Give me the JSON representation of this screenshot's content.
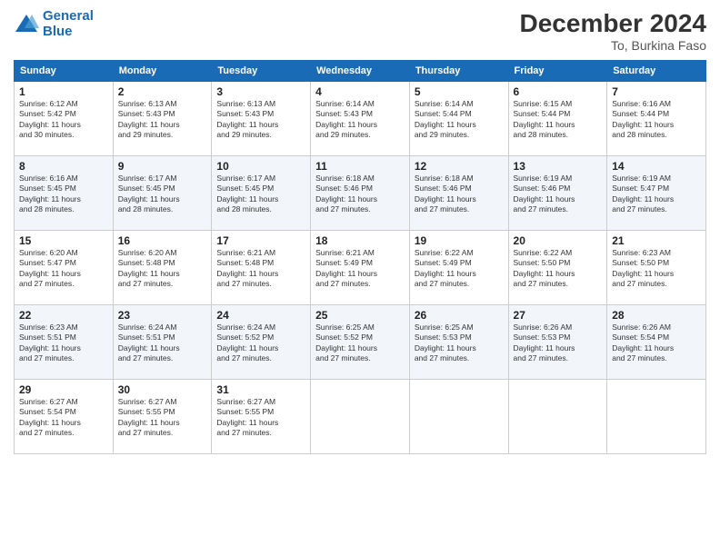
{
  "logo": {
    "line1": "General",
    "line2": "Blue"
  },
  "title": "December 2024",
  "location": "To, Burkina Faso",
  "days_header": [
    "Sunday",
    "Monday",
    "Tuesday",
    "Wednesday",
    "Thursday",
    "Friday",
    "Saturday"
  ],
  "weeks": [
    [
      {
        "day": "1",
        "info": "Sunrise: 6:12 AM\nSunset: 5:42 PM\nDaylight: 11 hours\nand 30 minutes."
      },
      {
        "day": "2",
        "info": "Sunrise: 6:13 AM\nSunset: 5:43 PM\nDaylight: 11 hours\nand 29 minutes."
      },
      {
        "day": "3",
        "info": "Sunrise: 6:13 AM\nSunset: 5:43 PM\nDaylight: 11 hours\nand 29 minutes."
      },
      {
        "day": "4",
        "info": "Sunrise: 6:14 AM\nSunset: 5:43 PM\nDaylight: 11 hours\nand 29 minutes."
      },
      {
        "day": "5",
        "info": "Sunrise: 6:14 AM\nSunset: 5:44 PM\nDaylight: 11 hours\nand 29 minutes."
      },
      {
        "day": "6",
        "info": "Sunrise: 6:15 AM\nSunset: 5:44 PM\nDaylight: 11 hours\nand 28 minutes."
      },
      {
        "day": "7",
        "info": "Sunrise: 6:16 AM\nSunset: 5:44 PM\nDaylight: 11 hours\nand 28 minutes."
      }
    ],
    [
      {
        "day": "8",
        "info": "Sunrise: 6:16 AM\nSunset: 5:45 PM\nDaylight: 11 hours\nand 28 minutes."
      },
      {
        "day": "9",
        "info": "Sunrise: 6:17 AM\nSunset: 5:45 PM\nDaylight: 11 hours\nand 28 minutes."
      },
      {
        "day": "10",
        "info": "Sunrise: 6:17 AM\nSunset: 5:45 PM\nDaylight: 11 hours\nand 28 minutes."
      },
      {
        "day": "11",
        "info": "Sunrise: 6:18 AM\nSunset: 5:46 PM\nDaylight: 11 hours\nand 27 minutes."
      },
      {
        "day": "12",
        "info": "Sunrise: 6:18 AM\nSunset: 5:46 PM\nDaylight: 11 hours\nand 27 minutes."
      },
      {
        "day": "13",
        "info": "Sunrise: 6:19 AM\nSunset: 5:46 PM\nDaylight: 11 hours\nand 27 minutes."
      },
      {
        "day": "14",
        "info": "Sunrise: 6:19 AM\nSunset: 5:47 PM\nDaylight: 11 hours\nand 27 minutes."
      }
    ],
    [
      {
        "day": "15",
        "info": "Sunrise: 6:20 AM\nSunset: 5:47 PM\nDaylight: 11 hours\nand 27 minutes."
      },
      {
        "day": "16",
        "info": "Sunrise: 6:20 AM\nSunset: 5:48 PM\nDaylight: 11 hours\nand 27 minutes."
      },
      {
        "day": "17",
        "info": "Sunrise: 6:21 AM\nSunset: 5:48 PM\nDaylight: 11 hours\nand 27 minutes."
      },
      {
        "day": "18",
        "info": "Sunrise: 6:21 AM\nSunset: 5:49 PM\nDaylight: 11 hours\nand 27 minutes."
      },
      {
        "day": "19",
        "info": "Sunrise: 6:22 AM\nSunset: 5:49 PM\nDaylight: 11 hours\nand 27 minutes."
      },
      {
        "day": "20",
        "info": "Sunrise: 6:22 AM\nSunset: 5:50 PM\nDaylight: 11 hours\nand 27 minutes."
      },
      {
        "day": "21",
        "info": "Sunrise: 6:23 AM\nSunset: 5:50 PM\nDaylight: 11 hours\nand 27 minutes."
      }
    ],
    [
      {
        "day": "22",
        "info": "Sunrise: 6:23 AM\nSunset: 5:51 PM\nDaylight: 11 hours\nand 27 minutes."
      },
      {
        "day": "23",
        "info": "Sunrise: 6:24 AM\nSunset: 5:51 PM\nDaylight: 11 hours\nand 27 minutes."
      },
      {
        "day": "24",
        "info": "Sunrise: 6:24 AM\nSunset: 5:52 PM\nDaylight: 11 hours\nand 27 minutes."
      },
      {
        "day": "25",
        "info": "Sunrise: 6:25 AM\nSunset: 5:52 PM\nDaylight: 11 hours\nand 27 minutes."
      },
      {
        "day": "26",
        "info": "Sunrise: 6:25 AM\nSunset: 5:53 PM\nDaylight: 11 hours\nand 27 minutes."
      },
      {
        "day": "27",
        "info": "Sunrise: 6:26 AM\nSunset: 5:53 PM\nDaylight: 11 hours\nand 27 minutes."
      },
      {
        "day": "28",
        "info": "Sunrise: 6:26 AM\nSunset: 5:54 PM\nDaylight: 11 hours\nand 27 minutes."
      }
    ],
    [
      {
        "day": "29",
        "info": "Sunrise: 6:27 AM\nSunset: 5:54 PM\nDaylight: 11 hours\nand 27 minutes."
      },
      {
        "day": "30",
        "info": "Sunrise: 6:27 AM\nSunset: 5:55 PM\nDaylight: 11 hours\nand 27 minutes."
      },
      {
        "day": "31",
        "info": "Sunrise: 6:27 AM\nSunset: 5:55 PM\nDaylight: 11 hours\nand 27 minutes."
      },
      {
        "day": "",
        "info": ""
      },
      {
        "day": "",
        "info": ""
      },
      {
        "day": "",
        "info": ""
      },
      {
        "day": "",
        "info": ""
      }
    ]
  ]
}
